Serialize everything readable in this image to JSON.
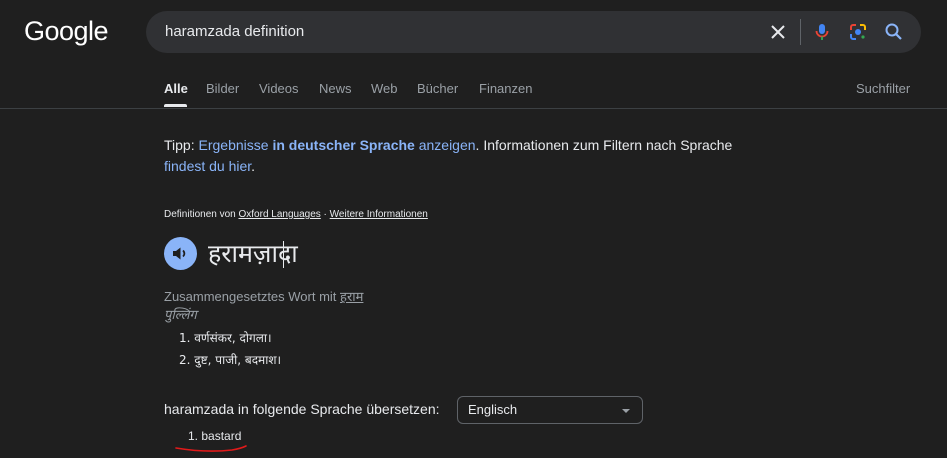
{
  "logo": "Google",
  "search": {
    "query": "haramzada definition"
  },
  "tabs": [
    {
      "label": "Alle",
      "active": true
    },
    {
      "label": "Bilder"
    },
    {
      "label": "Videos"
    },
    {
      "label": "News"
    },
    {
      "label": "Web"
    },
    {
      "label": "Bücher"
    },
    {
      "label": "Finanzen"
    }
  ],
  "tools_label": "Suchfilter",
  "tip": {
    "prefix": "Tipp: ",
    "link1": "Ergebnisse ",
    "link_bold": "in deutscher Sprache",
    "link2": " anzeigen",
    "middle": ". Informationen zum Filtern nach Sprache",
    "link3": "findest du hier",
    "suffix": "."
  },
  "definition": {
    "source_prefix": "Definitionen von ",
    "source_name": "Oxford Languages",
    "separator": " · ",
    "more_info": "Weitere Informationen",
    "headword": "हरामज़ादा",
    "compound_prefix": "Zusammengesetztes Wort mit ",
    "compound_root": "हराम",
    "part_of_speech": "पुल्लिंग",
    "senses": [
      "1. वर्णसंकर, दोगला।",
      "2. दुष्ट, पाजी, बदमाश।"
    ]
  },
  "translate": {
    "label": "haramzada in folgende Sprache übersetzen:",
    "selected_language": "Englisch",
    "results": [
      "1. bastard"
    ]
  },
  "colors": {
    "background": "#1f1f1f",
    "link": "#8ab4f8",
    "annotation": "#e21a1a"
  },
  "icons": [
    "clear-icon",
    "microphone-icon",
    "lens-icon",
    "search-icon",
    "speaker-icon",
    "dropdown-arrow-icon"
  ]
}
